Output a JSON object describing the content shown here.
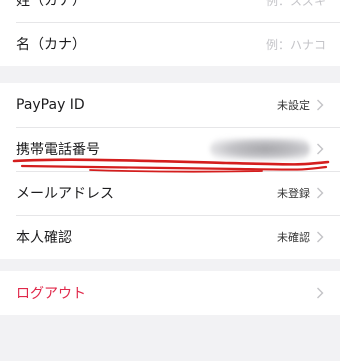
{
  "name_section": {
    "rows": [
      {
        "label": "姓（カナ）",
        "placeholder": "例：スズキ"
      },
      {
        "label": "名（カナ）",
        "placeholder": "例：ハナコ"
      }
    ]
  },
  "account_section": {
    "paypay": {
      "label": "PayPay ID",
      "value": "未設定"
    },
    "phone": {
      "label": "携帯電話番号"
    },
    "email": {
      "label": "メールアドレス",
      "value": "未登録"
    },
    "identity": {
      "label": "本人確認",
      "value": "未確認"
    }
  },
  "logout_section": {
    "label": "ログアウト"
  },
  "colors": {
    "danger": "#e0284a",
    "annotation": "#d41e1e"
  },
  "icons": {
    "chevron": "chevron-right-icon"
  }
}
